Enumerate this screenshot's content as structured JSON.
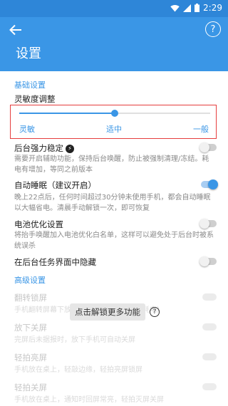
{
  "status_bar": {
    "time": "2:29",
    "icons": [
      "wifi-icon",
      "signal-icon",
      "battery-icon"
    ]
  },
  "header": {
    "title": "设置",
    "back_icon": "arrow-left-icon",
    "help_icon": "question-circle-icon",
    "help_glyph": "?"
  },
  "basic_section": {
    "title": "基础设置",
    "sensitivity": {
      "label": "灵敏度调整",
      "options": [
        "灵敏",
        "适中",
        "一般"
      ],
      "selected": "适中",
      "level": 0.5
    },
    "items": [
      {
        "title": "后台强力稳定",
        "badge_glyph": "⚡",
        "description": "需要开启辅助功能，保持后台唤醒，防止被强制清理/冻结。耗电有增加，等同之前版本",
        "enabled": false
      },
      {
        "title": "自动睡眠（建议开启）",
        "description": "晚上22点后，任何时间超过30分钟未使用手机，都会自动睡眠以大幅省电。清晨手动解锁一次，即可恢复",
        "enabled": true
      },
      {
        "title": "电池优化设置",
        "description": "将抬手唤醒加入电池优化白名单，这样可以避免处于后台时被系统误杀",
        "enabled": false
      },
      {
        "title": "在后台任务界面中隐藏",
        "enabled": false
      }
    ]
  },
  "advanced_section": {
    "title": "高级设置",
    "locked_items": [
      {
        "title": "翻转锁屏",
        "description": "手机翻转屏幕下放在桌面上，自动锁屏（耗电）"
      },
      {
        "title": "放下关屏",
        "description": "完屏后未据报时，放下手机可自动关屏"
      },
      {
        "title": "轻拍亮屏",
        "description": "手机放在桌上，轻敲边缘，轻拍亮屏锁屏"
      },
      {
        "title": "轻拍关屏",
        "description": "手机放在桌上，通知时回屏常亮，轻拍灭屏关屏"
      }
    ],
    "unlock_button": "点击解锁更多功能",
    "unlock_help_glyph": "?"
  },
  "colors": {
    "accent": "#3a96e6",
    "status_bar": "#2e86d8",
    "highlight_border": "#e63e3e"
  }
}
